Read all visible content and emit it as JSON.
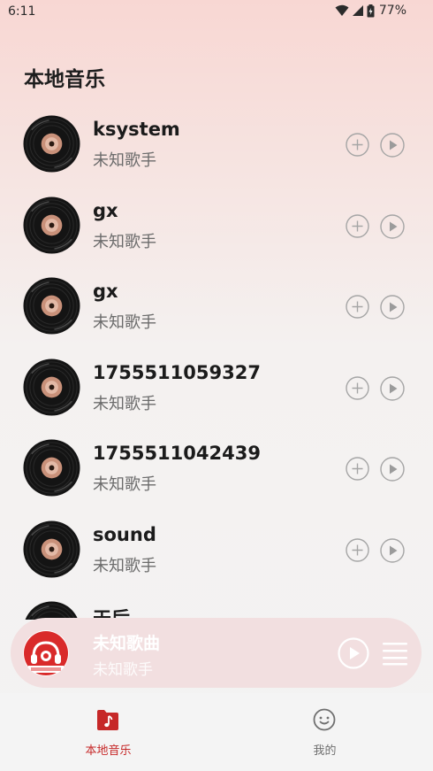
{
  "status_bar": {
    "time": "6:11",
    "battery": "77%"
  },
  "page": {
    "title": "本地音乐"
  },
  "songs": [
    {
      "title": "ksystem",
      "artist": "未知歌手"
    },
    {
      "title": "gx",
      "artist": "未知歌手"
    },
    {
      "title": "gx",
      "artist": "未知歌手"
    },
    {
      "title": "1755511059327",
      "artist": "未知歌手"
    },
    {
      "title": "1755511042439",
      "artist": "未知歌手"
    },
    {
      "title": "sound",
      "artist": "未知歌手"
    },
    {
      "title": "天后",
      "artist": ""
    }
  ],
  "mini_player": {
    "title": "未知歌曲",
    "artist": "未知歌手"
  },
  "tabs": [
    {
      "label": "本地音乐",
      "icon": "music-folder-icon",
      "active": true
    },
    {
      "label": "我的",
      "icon": "smiley-icon",
      "active": false
    }
  ],
  "colors": {
    "accent": "#c62828",
    "icon_gray": "#9b9b9b"
  }
}
